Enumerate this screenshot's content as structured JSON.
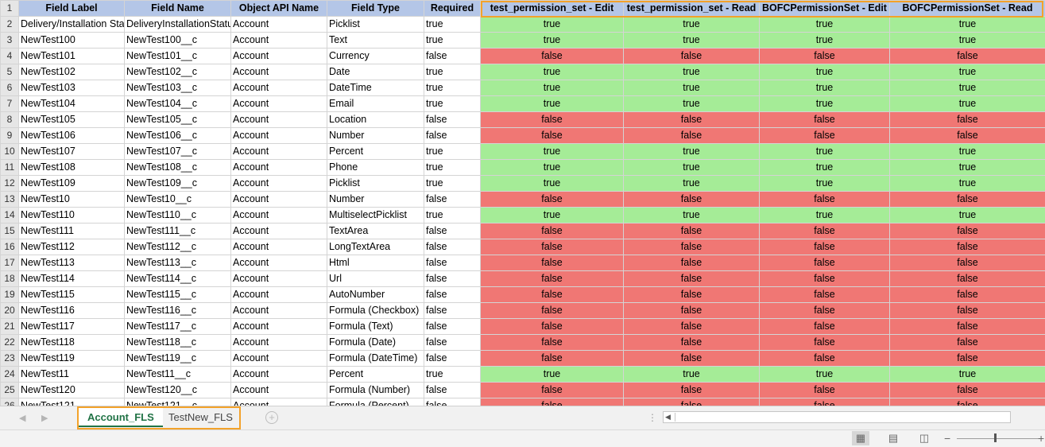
{
  "sheet": {
    "columns": [
      "Field Label",
      "Field Name",
      "Object API Name",
      "Field Type",
      "Required",
      "test_permission_set - Edit",
      "test_permission_set - Read",
      "BOFCPermissionSet - Edit",
      "BOFCPermissionSet - Read"
    ],
    "header_row_number": "1",
    "rows": [
      {
        "n": "2",
        "label": "Delivery/Installation Status",
        "name": "DeliveryInstallationStatus__c",
        "obj": "Account",
        "type": "Picklist",
        "req": "true",
        "p": [
          "true",
          "true",
          "true",
          "true"
        ]
      },
      {
        "n": "3",
        "label": "NewTest100",
        "name": "NewTest100__c",
        "obj": "Account",
        "type": "Text",
        "req": "true",
        "p": [
          "true",
          "true",
          "true",
          "true"
        ]
      },
      {
        "n": "4",
        "label": "NewTest101",
        "name": "NewTest101__c",
        "obj": "Account",
        "type": "Currency",
        "req": "false",
        "p": [
          "false",
          "false",
          "false",
          "false"
        ]
      },
      {
        "n": "5",
        "label": "NewTest102",
        "name": "NewTest102__c",
        "obj": "Account",
        "type": "Date",
        "req": "true",
        "p": [
          "true",
          "true",
          "true",
          "true"
        ]
      },
      {
        "n": "6",
        "label": "NewTest103",
        "name": "NewTest103__c",
        "obj": "Account",
        "type": "DateTime",
        "req": "true",
        "p": [
          "true",
          "true",
          "true",
          "true"
        ]
      },
      {
        "n": "7",
        "label": "NewTest104",
        "name": "NewTest104__c",
        "obj": "Account",
        "type": "Email",
        "req": "true",
        "p": [
          "true",
          "true",
          "true",
          "true"
        ]
      },
      {
        "n": "8",
        "label": "NewTest105",
        "name": "NewTest105__c",
        "obj": "Account",
        "type": "Location",
        "req": "false",
        "p": [
          "false",
          "false",
          "false",
          "false"
        ]
      },
      {
        "n": "9",
        "label": "NewTest106",
        "name": "NewTest106__c",
        "obj": "Account",
        "type": "Number",
        "req": "false",
        "p": [
          "false",
          "false",
          "false",
          "false"
        ]
      },
      {
        "n": "10",
        "label": "NewTest107",
        "name": "NewTest107__c",
        "obj": "Account",
        "type": "Percent",
        "req": "true",
        "p": [
          "true",
          "true",
          "true",
          "true"
        ]
      },
      {
        "n": "11",
        "label": "NewTest108",
        "name": "NewTest108__c",
        "obj": "Account",
        "type": "Phone",
        "req": "true",
        "p": [
          "true",
          "true",
          "true",
          "true"
        ]
      },
      {
        "n": "12",
        "label": "NewTest109",
        "name": "NewTest109__c",
        "obj": "Account",
        "type": "Picklist",
        "req": "true",
        "p": [
          "true",
          "true",
          "true",
          "true"
        ]
      },
      {
        "n": "13",
        "label": "NewTest10",
        "name": "NewTest10__c",
        "obj": "Account",
        "type": "Number",
        "req": "false",
        "p": [
          "false",
          "false",
          "false",
          "false"
        ]
      },
      {
        "n": "14",
        "label": "NewTest110",
        "name": "NewTest110__c",
        "obj": "Account",
        "type": "MultiselectPicklist",
        "req": "true",
        "p": [
          "true",
          "true",
          "true",
          "true"
        ]
      },
      {
        "n": "15",
        "label": "NewTest111",
        "name": "NewTest111__c",
        "obj": "Account",
        "type": "TextArea",
        "req": "false",
        "p": [
          "false",
          "false",
          "false",
          "false"
        ]
      },
      {
        "n": "16",
        "label": "NewTest112",
        "name": "NewTest112__c",
        "obj": "Account",
        "type": "LongTextArea",
        "req": "false",
        "p": [
          "false",
          "false",
          "false",
          "false"
        ]
      },
      {
        "n": "17",
        "label": "NewTest113",
        "name": "NewTest113__c",
        "obj": "Account",
        "type": "Html",
        "req": "false",
        "p": [
          "false",
          "false",
          "false",
          "false"
        ]
      },
      {
        "n": "18",
        "label": "NewTest114",
        "name": "NewTest114__c",
        "obj": "Account",
        "type": "Url",
        "req": "false",
        "p": [
          "false",
          "false",
          "false",
          "false"
        ]
      },
      {
        "n": "19",
        "label": "NewTest115",
        "name": "NewTest115__c",
        "obj": "Account",
        "type": "AutoNumber",
        "req": "false",
        "p": [
          "false",
          "false",
          "false",
          "false"
        ]
      },
      {
        "n": "20",
        "label": "NewTest116",
        "name": "NewTest116__c",
        "obj": "Account",
        "type": "Formula (Checkbox)",
        "req": "false",
        "p": [
          "false",
          "false",
          "false",
          "false"
        ]
      },
      {
        "n": "21",
        "label": "NewTest117",
        "name": "NewTest117__c",
        "obj": "Account",
        "type": "Formula (Text)",
        "req": "false",
        "p": [
          "false",
          "false",
          "false",
          "false"
        ]
      },
      {
        "n": "22",
        "label": "NewTest118",
        "name": "NewTest118__c",
        "obj": "Account",
        "type": "Formula (Date)",
        "req": "false",
        "p": [
          "false",
          "false",
          "false",
          "false"
        ]
      },
      {
        "n": "23",
        "label": "NewTest119",
        "name": "NewTest119__c",
        "obj": "Account",
        "type": "Formula (DateTime)",
        "req": "false",
        "p": [
          "false",
          "false",
          "false",
          "false"
        ]
      },
      {
        "n": "24",
        "label": "NewTest11",
        "name": "NewTest11__c",
        "obj": "Account",
        "type": "Percent",
        "req": "true",
        "p": [
          "true",
          "true",
          "true",
          "true"
        ]
      },
      {
        "n": "25",
        "label": "NewTest120",
        "name": "NewTest120__c",
        "obj": "Account",
        "type": "Formula (Number)",
        "req": "false",
        "p": [
          "false",
          "false",
          "false",
          "false"
        ]
      },
      {
        "n": "26",
        "label": "NewTest121",
        "name": "NewTest121__c",
        "obj": "Account",
        "type": "Formula (Percent)",
        "req": "false",
        "p": [
          "false",
          "false",
          "false",
          "false"
        ]
      }
    ]
  },
  "colors": {
    "true_fill": "#a5ec97",
    "false_fill": "#f07774",
    "header_fill": "#b4c6e7",
    "highlight": "#f3a22a",
    "active_tab": "#217346"
  },
  "tabs": [
    {
      "label": "Account_FLS",
      "active": true
    },
    {
      "label": "TestNew_FLS",
      "active": false
    }
  ],
  "icons": {
    "prev_sheet": "chevron-left-icon",
    "next_sheet": "chevron-right-icon",
    "add_sheet": "plus-circle-icon",
    "normal_view": "grid-view-icon",
    "page_layout": "page-layout-icon",
    "page_break": "page-break-icon",
    "zoom_out": "minus-icon",
    "zoom_in": "plus-icon"
  }
}
